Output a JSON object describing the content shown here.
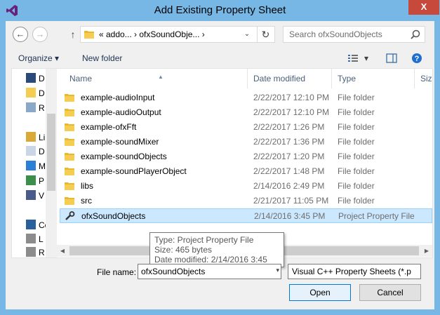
{
  "window": {
    "title": "Add Existing Property Sheet",
    "close_glyph": "X",
    "accent": "#76b7e6"
  },
  "nav": {
    "back_glyph": "←",
    "forward_glyph": "→",
    "up_glyph": "↑",
    "address_path": "«  addo...  ›  ofxSoundObje...  ›",
    "dropdown_glyph": "⌄",
    "refresh_glyph": "↻",
    "search_placeholder": "Search ofxSoundObjects"
  },
  "toolbar": {
    "organize_label": "Organize ▾",
    "new_folder_label": "New folder",
    "view_dd_glyph": "▾",
    "help_glyph": "?"
  },
  "navpane": {
    "items": [
      {
        "label": "D",
        "icon": "desktop-icon"
      },
      {
        "label": "D",
        "icon": "folder-icon"
      },
      {
        "label": "R",
        "icon": "recent-places-icon"
      },
      {
        "label": "Lib",
        "icon": "libraries-icon"
      },
      {
        "label": "D",
        "icon": "documents-icon"
      },
      {
        "label": "M",
        "icon": "music-icon"
      },
      {
        "label": "P",
        "icon": "pictures-icon"
      },
      {
        "label": "V",
        "icon": "videos-icon"
      },
      {
        "label": "Co",
        "icon": "computer-icon"
      },
      {
        "label": "L",
        "icon": "drive-icon"
      },
      {
        "label": "R",
        "icon": "drive-icon"
      }
    ]
  },
  "columns": {
    "name": "Name",
    "date": "Date modified",
    "type": "Type",
    "size": "Size"
  },
  "files": [
    {
      "name": "example-audioInput",
      "date": "2/22/2017 12:10 PM",
      "type": "File folder",
      "kind": "folder"
    },
    {
      "name": "example-audioOutput",
      "date": "2/22/2017 12:10 PM",
      "type": "File folder",
      "kind": "folder"
    },
    {
      "name": "example-ofxFft",
      "date": "2/22/2017 1:26 PM",
      "type": "File folder",
      "kind": "folder"
    },
    {
      "name": "example-soundMixer",
      "date": "2/22/2017 1:36 PM",
      "type": "File folder",
      "kind": "folder"
    },
    {
      "name": "example-soundObjects",
      "date": "2/22/2017 1:20 PM",
      "type": "File folder",
      "kind": "folder"
    },
    {
      "name": "example-soundPlayerObject",
      "date": "2/22/2017 1:48 PM",
      "type": "File folder",
      "kind": "folder"
    },
    {
      "name": "libs",
      "date": "2/14/2016 2:49 PM",
      "type": "File folder",
      "kind": "folder"
    },
    {
      "name": "src",
      "date": "2/21/2017 11:05 PM",
      "type": "File folder",
      "kind": "folder"
    },
    {
      "name": "ofxSoundObjects",
      "date": "2/14/2016 3:45 PM",
      "type": "Project Property File",
      "kind": "property"
    }
  ],
  "tooltip": {
    "line1": "Type: Project Property File",
    "line2": "Size: 465 bytes",
    "line3": "Date modified: 2/14/2016 3:45 PM"
  },
  "bottom": {
    "file_name_label": "File name:",
    "file_name_value": "ofxSoundObjects",
    "filter_value": "Visual C++ Property Sheets (*.p",
    "open_label": "Open",
    "cancel_label": "Cancel",
    "dd_glyph": "▾"
  }
}
